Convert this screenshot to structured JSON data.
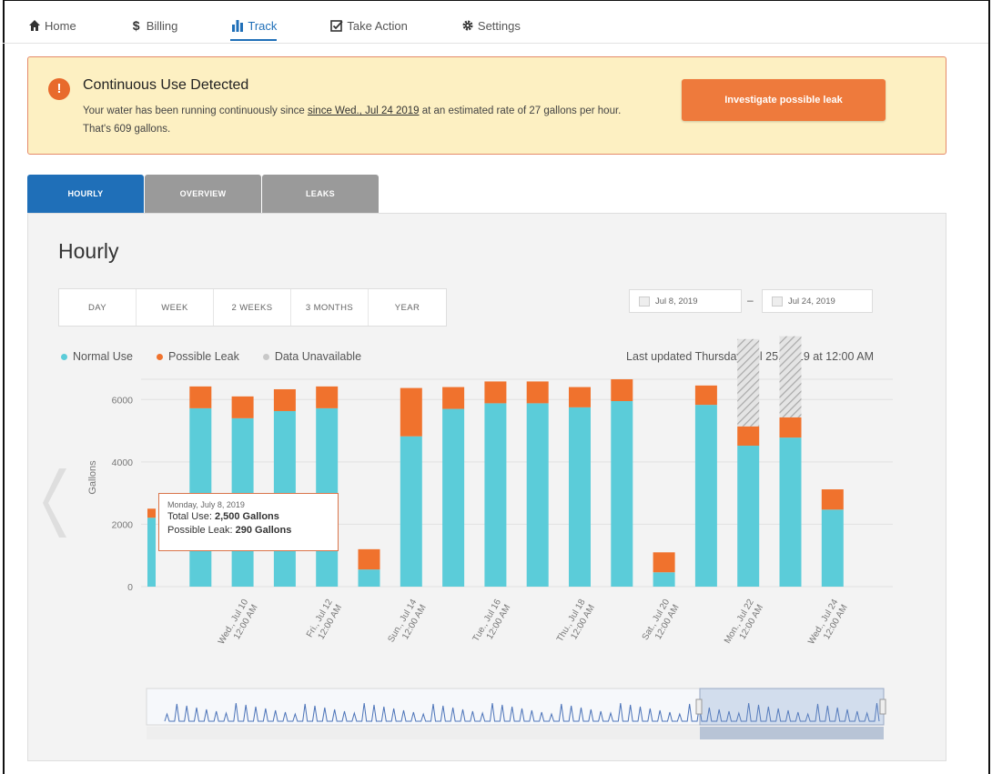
{
  "nav": {
    "items": [
      {
        "label": "Home",
        "icon": "home-icon"
      },
      {
        "label": "Billing",
        "icon": "dollar-icon"
      },
      {
        "label": "Track",
        "icon": "bar-chart-icon",
        "active": true
      },
      {
        "label": "Take Action",
        "icon": "checkbox-icon"
      },
      {
        "label": "Settings",
        "icon": "gear-icon"
      }
    ]
  },
  "alert": {
    "title": "Continuous Use Detected",
    "body_prefix": "Your water has been running continuously since ",
    "body_link": "since Wed., Jul 24 2019",
    "body_suffix": " at an estimated rate of 27 gallons per hour. That's 609 gallons.",
    "button": "Investigate possible leak"
  },
  "tabs": [
    {
      "label": "HOURLY",
      "active": true
    },
    {
      "label": "OVERVIEW",
      "active": false
    },
    {
      "label": "LEAKS",
      "active": false
    }
  ],
  "panel": {
    "title": "Hourly",
    "ranges": [
      "DAY",
      "WEEK",
      "2 WEEKS",
      "3 MONTHS",
      "YEAR"
    ],
    "date_from": "Jul 8, 2019",
    "date_to": "Jul 24, 2019",
    "legend": [
      "Normal Use",
      "Possible Leak",
      "Data Unavailable"
    ],
    "updated": "Last updated Thursday, Jul 25, 2019 at 12:00 AM"
  },
  "tooltip": {
    "date": "Monday, July 8, 2019",
    "total_label": "Total Use: ",
    "total_value": "2,500 Gallons",
    "leak_label": "Possible Leak: ",
    "leak_value": "290 Gallons"
  },
  "colors": {
    "normal": "#5bccd9",
    "leak": "#f0722d",
    "unavailable": "#c8c8c8",
    "accent": "#1f6fb8"
  },
  "chart_data": {
    "type": "bar",
    "stacked": true,
    "ylabel": "Gallons",
    "ylim": [
      0,
      7000
    ],
    "yticks": [
      0,
      2000,
      4000,
      6000
    ],
    "categories": [
      "Jul 8",
      "Jul 9",
      "Jul 10",
      "Jul 11",
      "Jul 12",
      "Jul 13",
      "Jul 14",
      "Jul 15",
      "Jul 16",
      "Jul 17",
      "Jul 18",
      "Jul 19",
      "Jul 20",
      "Jul 21",
      "Jul 22",
      "Jul 23",
      "Jul 24"
    ],
    "x_tick_labels": [
      {
        "index": 2,
        "lines": [
          "Wed., Jul 10",
          "12:00 AM"
        ]
      },
      {
        "index": 4,
        "lines": [
          "Fri., Jul 12",
          "12:00 AM"
        ]
      },
      {
        "index": 6,
        "lines": [
          "Sun., Jul 14",
          "12:00 AM"
        ]
      },
      {
        "index": 8,
        "lines": [
          "Tue., Jul 16",
          "12:00 AM"
        ]
      },
      {
        "index": 10,
        "lines": [
          "Thu., Jul 18",
          "12:00 AM"
        ]
      },
      {
        "index": 12,
        "lines": [
          "Sat., Jul 20",
          "12:00 AM"
        ]
      },
      {
        "index": 14,
        "lines": [
          "Mon., Jul 22",
          "12:00 AM"
        ]
      },
      {
        "index": 16,
        "lines": [
          "Wed., Jul 24",
          "12:00 AM"
        ]
      }
    ],
    "series": [
      {
        "name": "Normal Use",
        "values": [
          2210,
          5720,
          5400,
          5630,
          5720,
          550,
          4820,
          5700,
          5880,
          5880,
          5750,
          5950,
          460,
          5830,
          4520,
          4780,
          2470
        ]
      },
      {
        "name": "Possible Leak",
        "values": [
          290,
          700,
          700,
          700,
          700,
          650,
          1550,
          700,
          700,
          700,
          650,
          700,
          640,
          620,
          620,
          650,
          650
        ]
      },
      {
        "name": "Data Unavailable",
        "values": [
          0,
          0,
          0,
          0,
          0,
          0,
          0,
          0,
          0,
          0,
          0,
          0,
          0,
          0,
          2800,
          2600,
          0
        ]
      }
    ],
    "legend_position": "top-left"
  }
}
